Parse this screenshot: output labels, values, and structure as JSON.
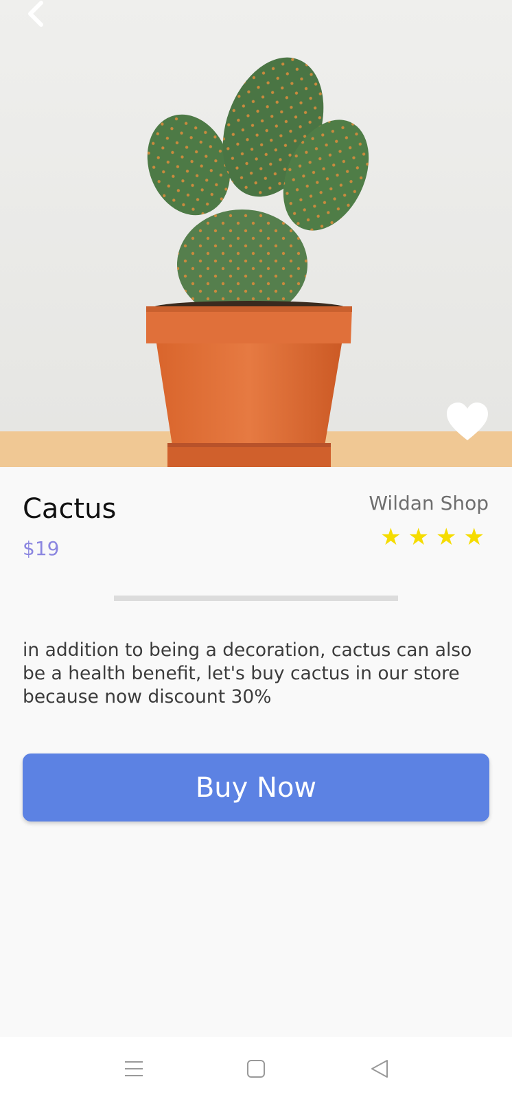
{
  "product": {
    "name": "Cactus",
    "price": "$19",
    "shop": "Wildan Shop",
    "rating": 4,
    "stars_text": "★★★★",
    "description": "in addition to being a decoration, cactus can also be a health benefit, let's buy cactus in our store because now discount 30%"
  },
  "actions": {
    "buy_label": "Buy Now"
  },
  "icons": {
    "back": "chevron-left-icon",
    "favorite": "heart-icon",
    "menu": "menu-icon",
    "home": "home-square-icon",
    "back_nav": "triangle-back-icon"
  },
  "colors": {
    "accent": "#5c82e3",
    "price": "#8b86e0",
    "star": "#f5dc00",
    "background": "#f9f9f9"
  }
}
